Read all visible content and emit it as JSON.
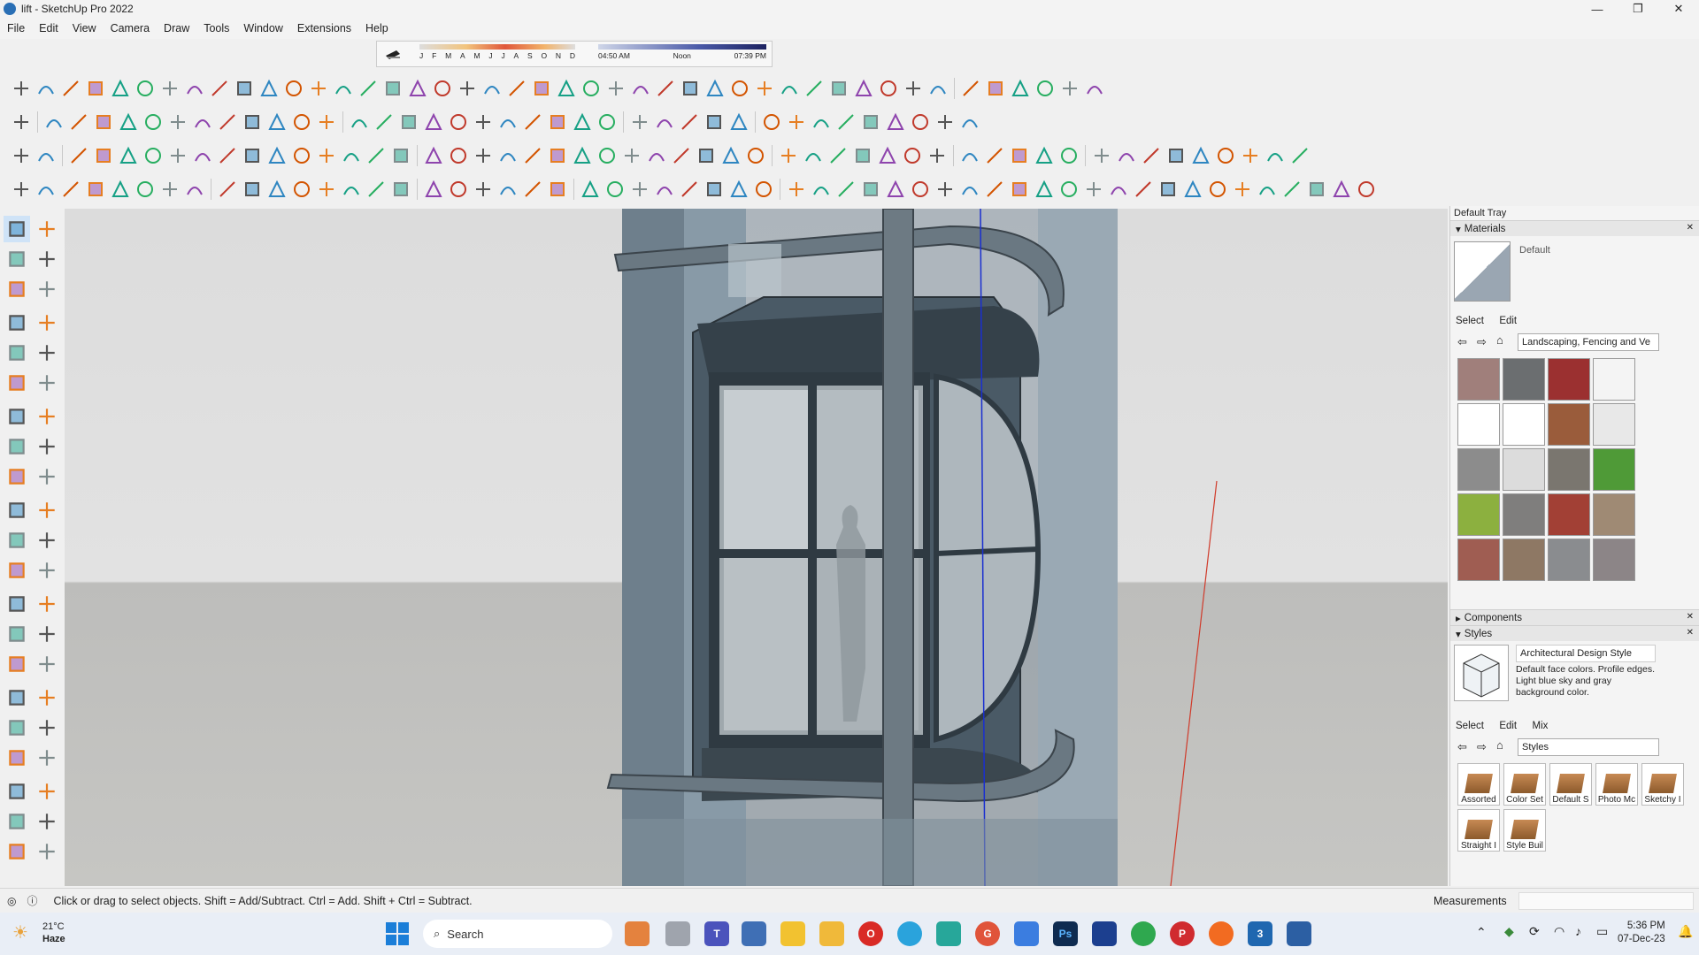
{
  "window": {
    "title": "lift - SketchUp Pro 2022"
  },
  "window_controls": [
    "—",
    "❐",
    "✕"
  ],
  "menu": [
    "File",
    "Edit",
    "View",
    "Camera",
    "Draw",
    "Tools",
    "Window",
    "Extensions",
    "Help"
  ],
  "shadows": {
    "months": [
      "J",
      "F",
      "M",
      "A",
      "M",
      "J",
      "J",
      "A",
      "S",
      "O",
      "N",
      "D"
    ],
    "time_start": "04:50 AM",
    "time_mid": "Noon",
    "time_end": "07:39 PM"
  },
  "tray": {
    "title": "Default Tray",
    "materials": {
      "header": "Materials",
      "current": "Default",
      "tabs": [
        "Select",
        "Edit"
      ],
      "collection": "Landscaping, Fencing and Ve",
      "swatch_colors": [
        "#a07f7b",
        "#6b6e70",
        "#9b3030",
        "#f4f4f4",
        "#ffffff",
        "#ffffff",
        "#9a5c3b",
        "#e8e8e8",
        "#8c8c8c",
        "#dcdcdc",
        "#7a766f",
        "#4f9a37",
        "#8cb03f",
        "#7f7e7d",
        "#a24035",
        "#9f8a74",
        "#9f5d52",
        "#8e7864",
        "#8a8c8f",
        "#8c8587"
      ]
    },
    "components": {
      "header": "Components"
    },
    "styles": {
      "header": "Styles",
      "name": "Architectural Design Style",
      "description": "Default face colors. Profile edges. Light blue sky and gray background color.",
      "tabs": [
        "Select",
        "Edit",
        "Mix"
      ],
      "collection": "Styles",
      "tiles": [
        "Assorted",
        "Color Set",
        "Default S",
        "Photo Mc",
        "Sketchy I",
        "Straight I",
        "Style Buil"
      ]
    }
  },
  "status": {
    "hint": "Click or drag to select objects. Shift = Add/Subtract. Ctrl = Add. Shift + Ctrl = Subtract.",
    "measurements_label": "Measurements",
    "measurements_value": ""
  },
  "taskbar": {
    "weather_temp": "21°C",
    "weather_desc": "Haze",
    "search_placeholder": "Search",
    "time": "5:36 PM",
    "date": "07-Dec-23"
  }
}
